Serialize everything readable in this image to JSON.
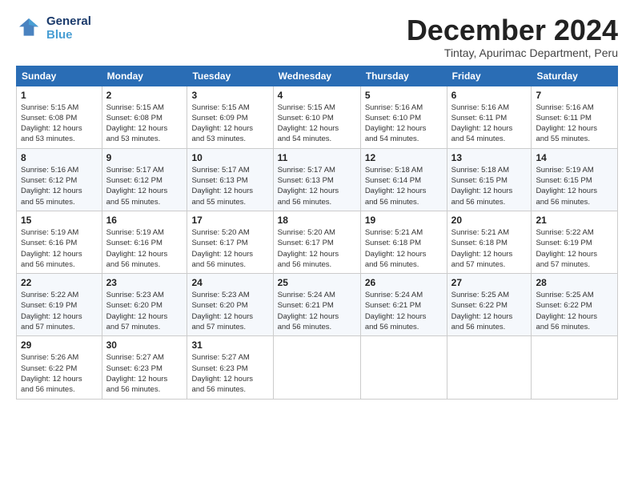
{
  "header": {
    "logo_line1": "General",
    "logo_line2": "Blue",
    "month_title": "December 2024",
    "subtitle": "Tintay, Apurimac Department, Peru"
  },
  "calendar": {
    "days_of_week": [
      "Sunday",
      "Monday",
      "Tuesday",
      "Wednesday",
      "Thursday",
      "Friday",
      "Saturday"
    ],
    "weeks": [
      [
        {
          "num": "",
          "info": ""
        },
        {
          "num": "2",
          "info": "Sunrise: 5:15 AM\nSunset: 6:08 PM\nDaylight: 12 hours\nand 53 minutes."
        },
        {
          "num": "3",
          "info": "Sunrise: 5:15 AM\nSunset: 6:09 PM\nDaylight: 12 hours\nand 53 minutes."
        },
        {
          "num": "4",
          "info": "Sunrise: 5:15 AM\nSunset: 6:10 PM\nDaylight: 12 hours\nand 54 minutes."
        },
        {
          "num": "5",
          "info": "Sunrise: 5:16 AM\nSunset: 6:10 PM\nDaylight: 12 hours\nand 54 minutes."
        },
        {
          "num": "6",
          "info": "Sunrise: 5:16 AM\nSunset: 6:11 PM\nDaylight: 12 hours\nand 54 minutes."
        },
        {
          "num": "7",
          "info": "Sunrise: 5:16 AM\nSunset: 6:11 PM\nDaylight: 12 hours\nand 55 minutes."
        }
      ],
      [
        {
          "num": "8",
          "info": "Sunrise: 5:16 AM\nSunset: 6:12 PM\nDaylight: 12 hours\nand 55 minutes."
        },
        {
          "num": "9",
          "info": "Sunrise: 5:17 AM\nSunset: 6:12 PM\nDaylight: 12 hours\nand 55 minutes."
        },
        {
          "num": "10",
          "info": "Sunrise: 5:17 AM\nSunset: 6:13 PM\nDaylight: 12 hours\nand 55 minutes."
        },
        {
          "num": "11",
          "info": "Sunrise: 5:17 AM\nSunset: 6:13 PM\nDaylight: 12 hours\nand 56 minutes."
        },
        {
          "num": "12",
          "info": "Sunrise: 5:18 AM\nSunset: 6:14 PM\nDaylight: 12 hours\nand 56 minutes."
        },
        {
          "num": "13",
          "info": "Sunrise: 5:18 AM\nSunset: 6:15 PM\nDaylight: 12 hours\nand 56 minutes."
        },
        {
          "num": "14",
          "info": "Sunrise: 5:19 AM\nSunset: 6:15 PM\nDaylight: 12 hours\nand 56 minutes."
        }
      ],
      [
        {
          "num": "15",
          "info": "Sunrise: 5:19 AM\nSunset: 6:16 PM\nDaylight: 12 hours\nand 56 minutes."
        },
        {
          "num": "16",
          "info": "Sunrise: 5:19 AM\nSunset: 6:16 PM\nDaylight: 12 hours\nand 56 minutes."
        },
        {
          "num": "17",
          "info": "Sunrise: 5:20 AM\nSunset: 6:17 PM\nDaylight: 12 hours\nand 56 minutes."
        },
        {
          "num": "18",
          "info": "Sunrise: 5:20 AM\nSunset: 6:17 PM\nDaylight: 12 hours\nand 56 minutes."
        },
        {
          "num": "19",
          "info": "Sunrise: 5:21 AM\nSunset: 6:18 PM\nDaylight: 12 hours\nand 56 minutes."
        },
        {
          "num": "20",
          "info": "Sunrise: 5:21 AM\nSunset: 6:18 PM\nDaylight: 12 hours\nand 57 minutes."
        },
        {
          "num": "21",
          "info": "Sunrise: 5:22 AM\nSunset: 6:19 PM\nDaylight: 12 hours\nand 57 minutes."
        }
      ],
      [
        {
          "num": "22",
          "info": "Sunrise: 5:22 AM\nSunset: 6:19 PM\nDaylight: 12 hours\nand 57 minutes."
        },
        {
          "num": "23",
          "info": "Sunrise: 5:23 AM\nSunset: 6:20 PM\nDaylight: 12 hours\nand 57 minutes."
        },
        {
          "num": "24",
          "info": "Sunrise: 5:23 AM\nSunset: 6:20 PM\nDaylight: 12 hours\nand 57 minutes."
        },
        {
          "num": "25",
          "info": "Sunrise: 5:24 AM\nSunset: 6:21 PM\nDaylight: 12 hours\nand 56 minutes."
        },
        {
          "num": "26",
          "info": "Sunrise: 5:24 AM\nSunset: 6:21 PM\nDaylight: 12 hours\nand 56 minutes."
        },
        {
          "num": "27",
          "info": "Sunrise: 5:25 AM\nSunset: 6:22 PM\nDaylight: 12 hours\nand 56 minutes."
        },
        {
          "num": "28",
          "info": "Sunrise: 5:25 AM\nSunset: 6:22 PM\nDaylight: 12 hours\nand 56 minutes."
        }
      ],
      [
        {
          "num": "29",
          "info": "Sunrise: 5:26 AM\nSunset: 6:22 PM\nDaylight: 12 hours\nand 56 minutes."
        },
        {
          "num": "30",
          "info": "Sunrise: 5:27 AM\nSunset: 6:23 PM\nDaylight: 12 hours\nand 56 minutes."
        },
        {
          "num": "31",
          "info": "Sunrise: 5:27 AM\nSunset: 6:23 PM\nDaylight: 12 hours\nand 56 minutes."
        },
        {
          "num": "",
          "info": ""
        },
        {
          "num": "",
          "info": ""
        },
        {
          "num": "",
          "info": ""
        },
        {
          "num": "",
          "info": ""
        }
      ]
    ],
    "week1_day1": {
      "num": "1",
      "info": "Sunrise: 5:15 AM\nSunset: 6:08 PM\nDaylight: 12 hours\nand 53 minutes."
    }
  }
}
